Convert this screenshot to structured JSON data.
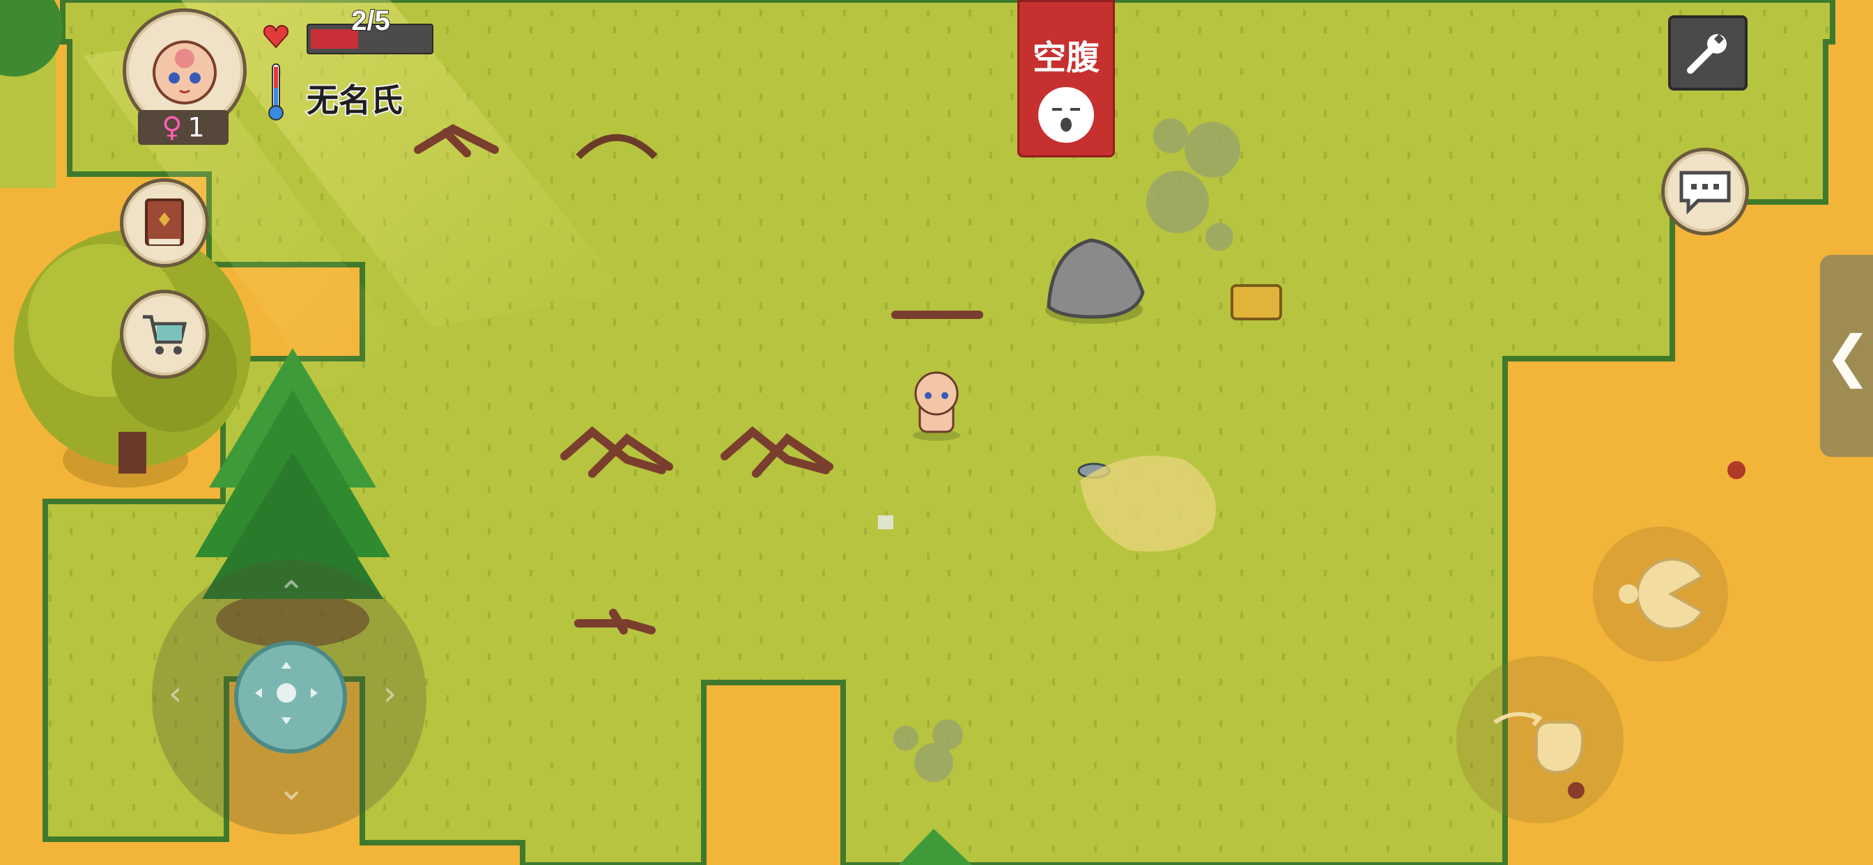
{
  "player": {
    "name": "无名氏",
    "hp_text": "2/5",
    "hp_fraction": 0.4,
    "gender_symbol": "♀",
    "age": "1"
  },
  "status": {
    "hunger_label": "空腹"
  },
  "icons": {
    "settings": "wrench-icon",
    "chat": "speech-bubble-icon",
    "recipe_book": "book-icon",
    "shop": "shopping-cart-icon",
    "eat": "eat-icon",
    "grab": "hand-icon",
    "side_tab": "chevron-left-icon",
    "heart": "heart-icon",
    "temperature": "thermometer-icon"
  },
  "side_tab_glyph": "❮",
  "colors": {
    "grass": "#b6c43c",
    "sand": "#f3b43a",
    "hp_fill": "#c82f37",
    "hunger_banner": "#c6302e"
  }
}
